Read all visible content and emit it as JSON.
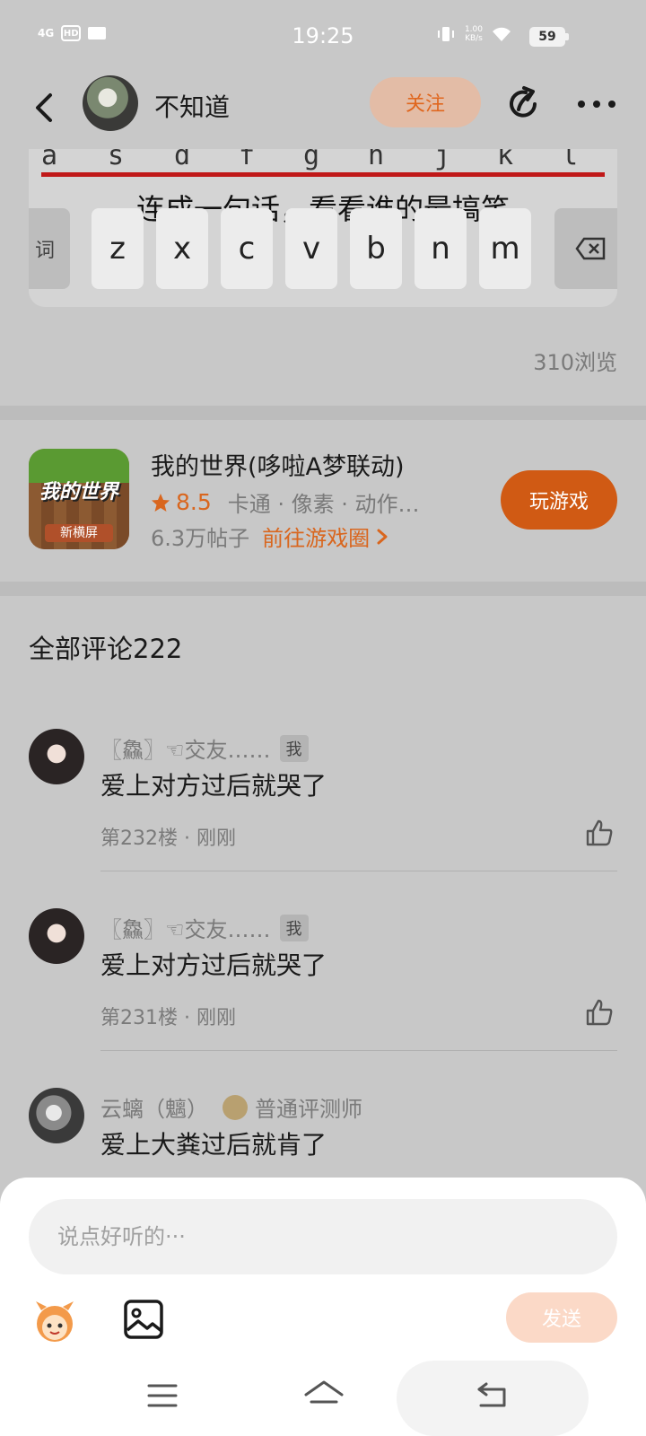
{
  "status_bar": {
    "network": "4G",
    "hd": "HD",
    "time": "19:25",
    "speed_value": "1.00",
    "speed_unit": "KB/s",
    "battery": "59"
  },
  "header": {
    "author_name": "不知道",
    "follow_label": "关注"
  },
  "post_image": {
    "top_keys": [
      "a",
      "s",
      "d",
      "f",
      "g",
      "h",
      "j",
      "k",
      "l"
    ],
    "overlay_text": "连成一句话，看看谁的最搞笑",
    "side_key_label": "词",
    "bottom_keys": [
      "z",
      "x",
      "c",
      "v",
      "b",
      "n",
      "m"
    ]
  },
  "post": {
    "view_count": "310浏览"
  },
  "game_card": {
    "icon_title": "我的世界",
    "icon_subtitle": "新横屏",
    "title": "我的世界(哆啦A梦联动)",
    "rating": "8.5",
    "tags": "卡通 · 像素 · 动作…",
    "posts": "6.3万帖子",
    "circle_link": "前往游戏圈",
    "play_label": "玩游戏",
    "accent_color": "#d05a14"
  },
  "comments": {
    "header": "全部评论222",
    "items": [
      {
        "user": "〖鱻〗☜交友……",
        "badge": "我",
        "text": "爱上对方过后就哭了",
        "meta": "第232楼 · 刚刚"
      },
      {
        "user": "〖鱻〗☜交友……",
        "badge": "我",
        "text": "爱上对方过后就哭了",
        "meta": "第231楼 · 刚刚"
      },
      {
        "user": "云螭（魑）",
        "reviewer_title": "普通评测师",
        "text": "爱上大粪过后就肯了"
      }
    ]
  },
  "compose": {
    "placeholder": "说点好听的···",
    "send_label": "发送"
  }
}
